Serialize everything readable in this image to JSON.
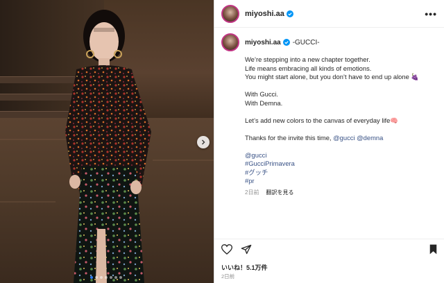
{
  "post": {
    "username": "miyoshi.aa",
    "caption_title": "-GUCCI-",
    "caption_lines": [
      "We’re stepping into a new chapter together.",
      "Life means embracing all kinds of emotions.",
      "You might start alone, but you don’t have to end up alone 🍇",
      "",
      "With Gucci.",
      "With Demna.",
      "",
      "Let’s add new colors to the canvas of everyday life🧠",
      "",
      "Thanks for the invite this time,"
    ],
    "mention_gucci": "@gucci",
    "mention_demna": "@demna",
    "tags": [
      "@gucci",
      "#GucciPrimavera",
      "#グッチ",
      "#pr"
    ],
    "time_ago": "2日前",
    "translate_label": "翻訳を見る",
    "likes_label": "いいね！5.1万件",
    "date_label": "2日前"
  },
  "header": {
    "more_icon": "more-icon",
    "more_glyph": "•••"
  },
  "carousel": {
    "dots": 7,
    "active": 0
  },
  "colors": {
    "verified": "#0095f6",
    "link": "#385185",
    "meta": "#8e8e8e",
    "active_dot": "#2f7cf0"
  }
}
